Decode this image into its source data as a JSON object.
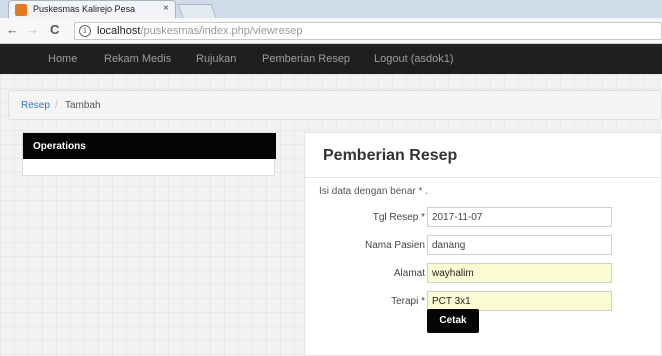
{
  "browser": {
    "tab_title": "Puskesmas Kalirejo Pesa",
    "tab_close": "×",
    "back_icon": "←",
    "forward_icon": "→",
    "reload_icon": "C",
    "info_icon": "i",
    "url_host": "localhost",
    "url_path": "/puskesmas/index.php/viewresep"
  },
  "navbar": {
    "items": [
      "Home",
      "Rekam Medis",
      "Rujukan",
      "Pemberian Resep",
      "Logout (asdok1)"
    ]
  },
  "breadcrumb": {
    "link": "Resep",
    "separator": "/",
    "current": "Tambah"
  },
  "sidebar": {
    "title": "Operations"
  },
  "form": {
    "title": "Pemberian Resep",
    "hint": "Isi data dengan benar * .",
    "fields": [
      {
        "label": "Tgl Resep *",
        "value": "2017-11-07"
      },
      {
        "label": "Nama Pasien",
        "value": "danang"
      },
      {
        "label": "Alamat",
        "value": "wayhalim"
      },
      {
        "label": "Terapi *",
        "value": "PCT 3x1"
      }
    ],
    "submit_label": "Cetak"
  },
  "colors": {
    "navbar_bg": "#1f1f1f",
    "link": "#337ab7",
    "autofill_bg": "#fafbd0"
  }
}
